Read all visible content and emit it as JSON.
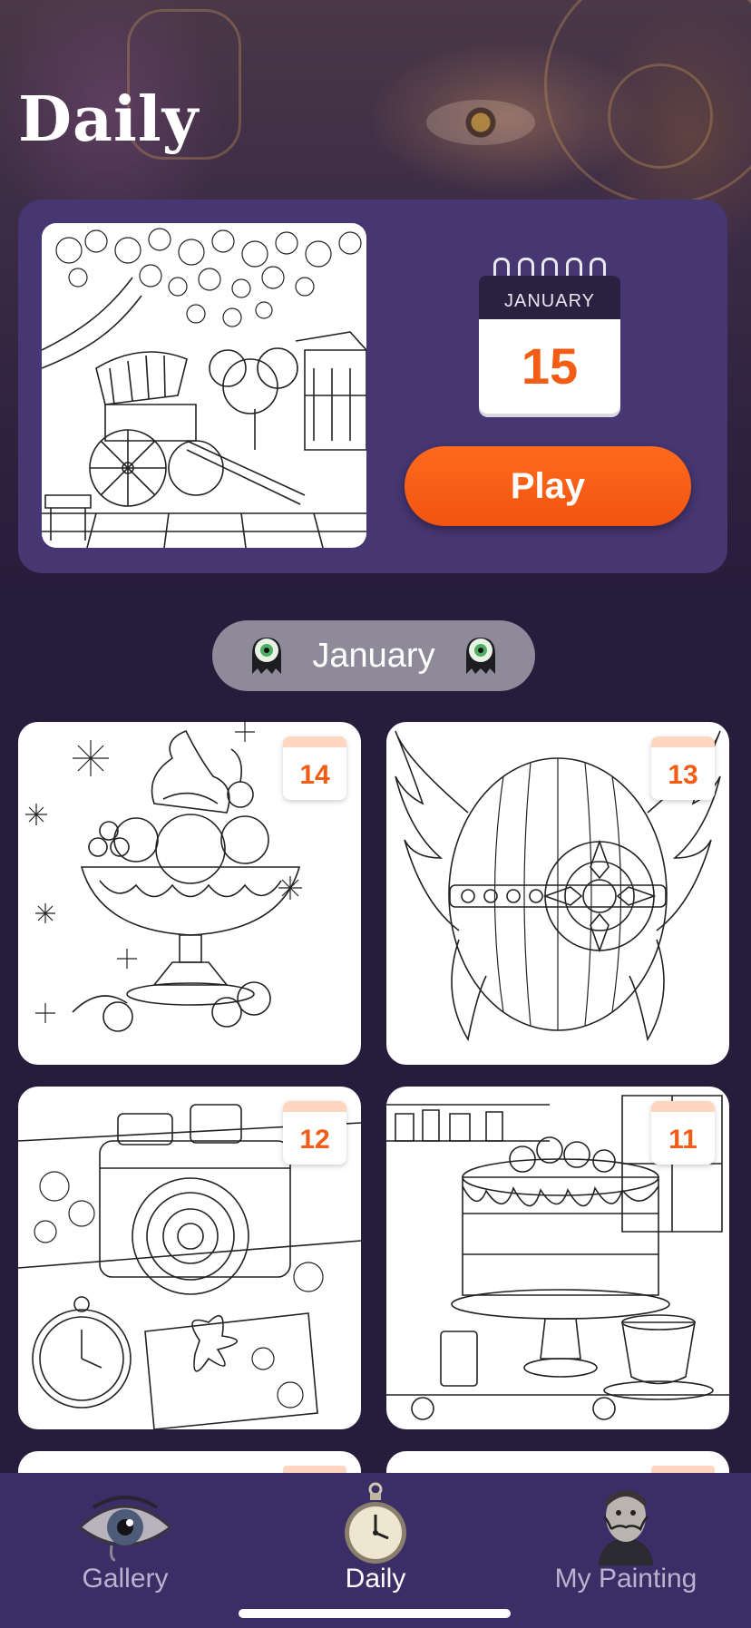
{
  "header": {
    "title": "Daily"
  },
  "featured": {
    "calendar_month": "JANUARY",
    "calendar_day": "15",
    "play_label": "Play",
    "image_icon": "rickshaw-cherry-blossom-artwork"
  },
  "month_selector": {
    "label": "January",
    "left_icon": "eyeball-icon",
    "right_icon": "eyeball-icon"
  },
  "tiles": [
    {
      "day": "14",
      "artwork": "ice-cream-sundae"
    },
    {
      "day": "13",
      "artwork": "winged-egg"
    },
    {
      "day": "12",
      "artwork": "camera-and-clock"
    },
    {
      "day": "11",
      "artwork": "layer-cake"
    }
  ],
  "tabbar": {
    "items": [
      {
        "label": "Gallery",
        "icon": "eye-icon",
        "active": false
      },
      {
        "label": "Daily",
        "icon": "pocket-watch-icon",
        "active": true
      },
      {
        "label": "My Painting",
        "icon": "portrait-icon",
        "active": false
      }
    ]
  },
  "colors": {
    "accent": "#f25c14",
    "card": "#463671",
    "background": "#261c3c",
    "tabbar": "#3b2d66"
  }
}
